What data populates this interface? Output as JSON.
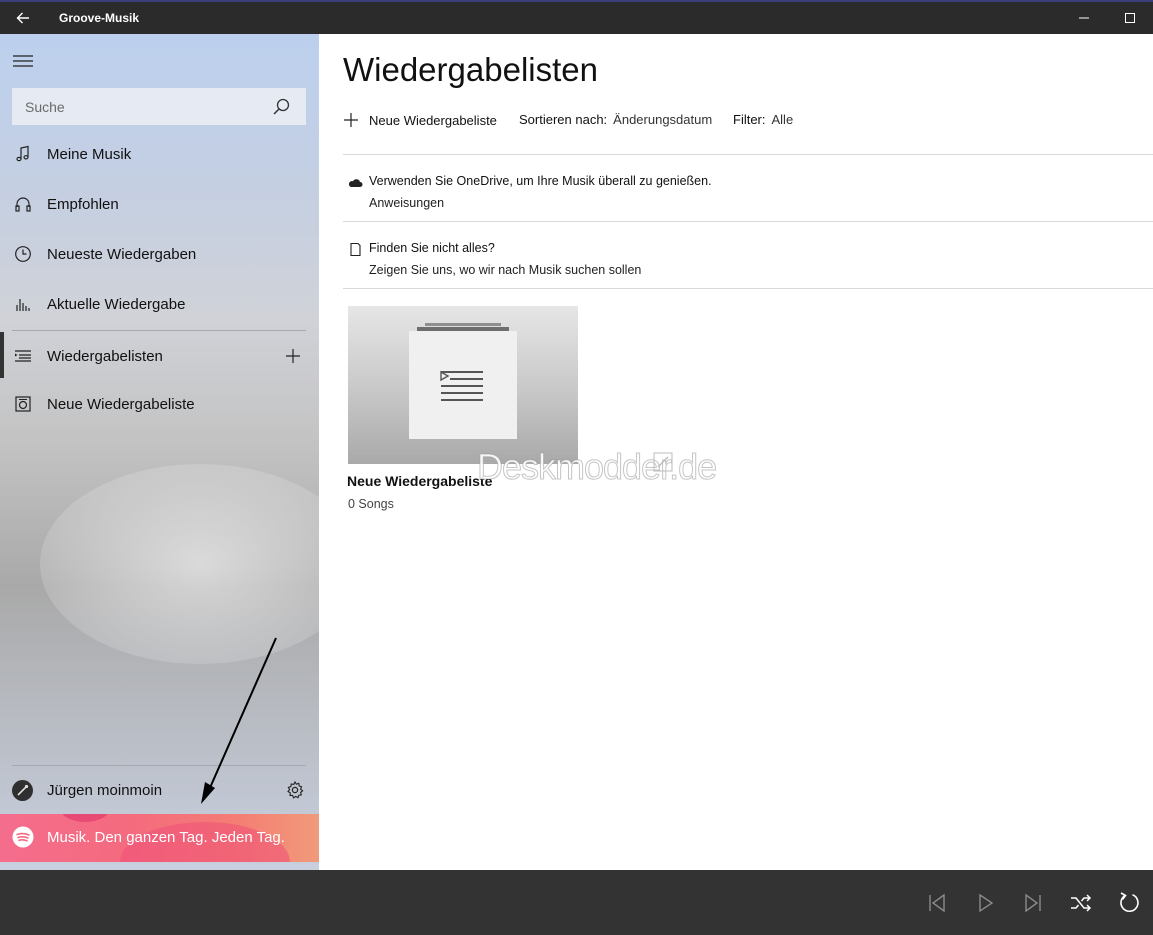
{
  "window": {
    "title": "Groove-Musik",
    "back_icon": "back-arrow-icon",
    "minimize_icon": "minimize-icon",
    "maximize_icon": "maximize-icon"
  },
  "sidebar": {
    "menu_icon": "hamburger-icon",
    "search": {
      "placeholder": "Suche",
      "value": "",
      "icon": "search-icon"
    },
    "items": [
      {
        "label": "Meine Musik",
        "icon": "music-note-icon"
      },
      {
        "label": "Empfohlen",
        "icon": "headphones-icon"
      },
      {
        "label": "Neueste Wiedergaben",
        "icon": "clock-icon"
      },
      {
        "label": "Aktuelle Wiedergabe",
        "icon": "equalizer-icon"
      },
      {
        "label": "Wiedergabelisten",
        "icon": "playlist-icon",
        "selected": true,
        "action_icon": "plus-icon"
      },
      {
        "label": "Neue Wiedergabeliste",
        "icon": "playlist-item-icon"
      }
    ],
    "user": {
      "name": "Jürgen moinmoin",
      "settings_icon": "gear-icon"
    },
    "promo": {
      "text": "Musik. Den ganzen Tag. Jeden Tag.",
      "icon": "spotify-icon"
    }
  },
  "main": {
    "title": "Wiedergabelisten",
    "commands": {
      "new_playlist": "Neue Wiedergabeliste",
      "sort_label": "Sortieren nach:",
      "sort_value": "Änderungsdatum",
      "filter_label": "Filter:",
      "filter_value": "Alle"
    },
    "notices": [
      {
        "icon": "cloud-icon",
        "title": "Verwenden Sie OneDrive, um Ihre Musik überall zu genießen.",
        "link": "Anweisungen"
      },
      {
        "icon": "document-icon",
        "title": "Finden Sie nicht alles?",
        "link": "Zeigen Sie uns, wo wir nach Musik suchen sollen"
      }
    ],
    "playlists": [
      {
        "name": "Neue Wiedergabeliste",
        "count": "0 Songs"
      }
    ],
    "watermark": "Deskmodder.de"
  },
  "player": {
    "buttons": [
      "previous-icon",
      "play-icon",
      "next-icon",
      "shuffle-icon",
      "repeat-icon"
    ]
  },
  "colors": {
    "titlebar": "#2b2b2b",
    "player_bar": "#333333",
    "promo": "#f56d8d"
  }
}
